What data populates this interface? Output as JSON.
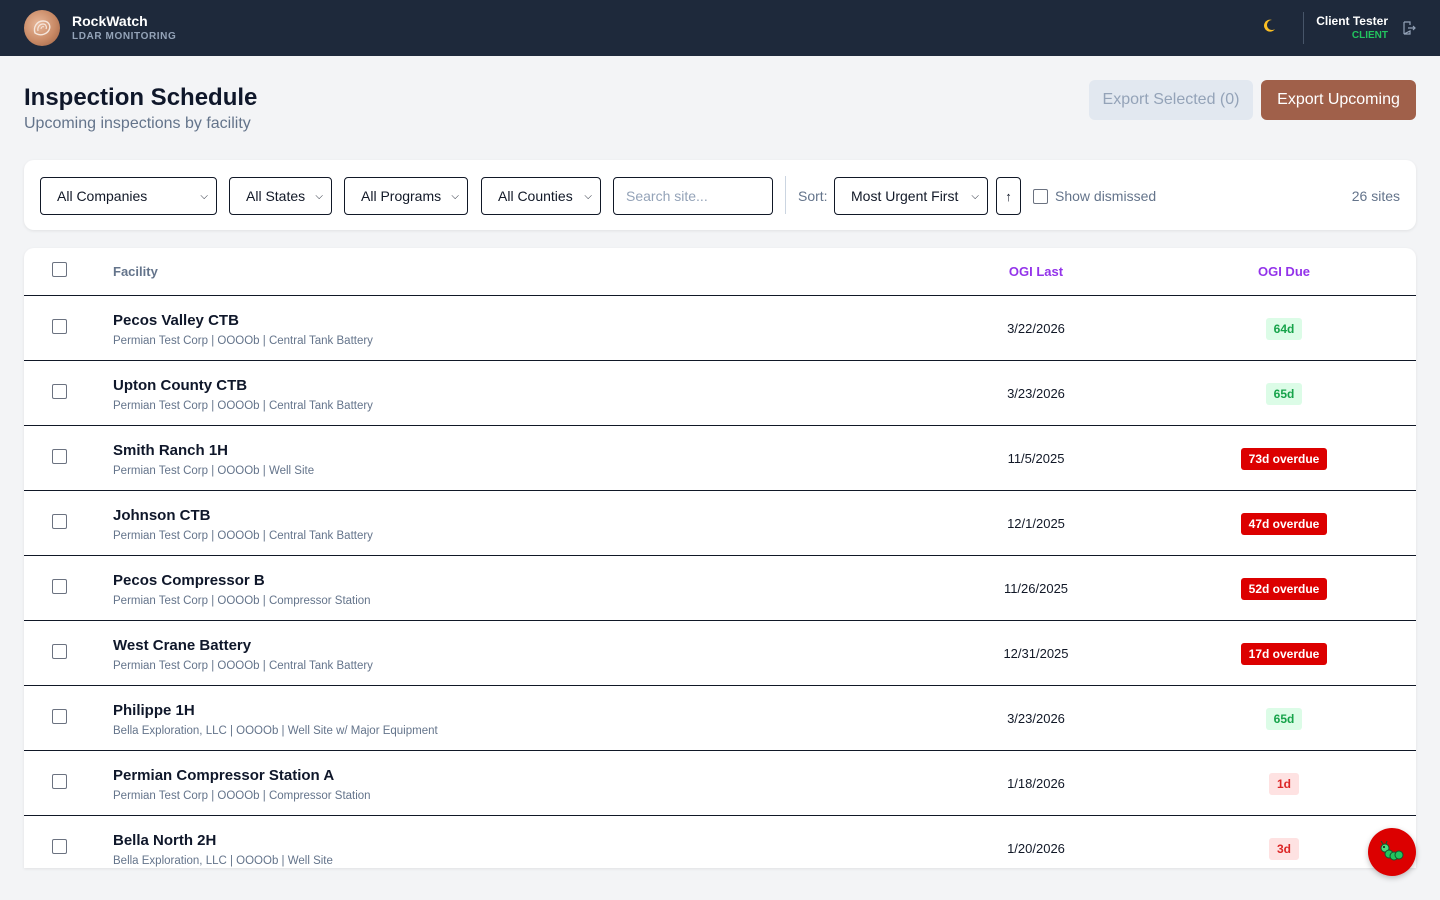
{
  "app": {
    "name": "RockWatch",
    "subtitle": "LDAR MONITORING",
    "logo_icon": "rock-logo-icon"
  },
  "user": {
    "name": "Client Tester",
    "role": "CLIENT",
    "theme_icon": "moon-icon",
    "logout_icon": "logout-icon"
  },
  "header": {
    "title": "Inspection Schedule",
    "subtitle": "Upcoming inspections by facility",
    "export_selected_label": "Export Selected (0)",
    "export_upcoming_label": "Export Upcoming"
  },
  "filters": {
    "company": "All Companies",
    "state": "All States",
    "program": "All Programs",
    "county": "All Counties",
    "search_placeholder": "Search site...",
    "sort_label": "Sort:",
    "sort_value": "Most Urgent First",
    "sort_direction": "↑",
    "show_dismissed_label": "Show dismissed",
    "site_count": "26 sites"
  },
  "table": {
    "columns": {
      "facility": "Facility",
      "ogi_last": "OGI Last",
      "ogi_due": "OGI Due"
    },
    "rows": [
      {
        "name": "Pecos Valley CTB",
        "meta": "Permian Test Corp | OOOOb | Central Tank Battery",
        "ogi_last": "3/22/2026",
        "ogi_due": "64d",
        "status": "ok"
      },
      {
        "name": "Upton County CTB",
        "meta": "Permian Test Corp | OOOOb | Central Tank Battery",
        "ogi_last": "3/23/2026",
        "ogi_due": "65d",
        "status": "ok"
      },
      {
        "name": "Smith Ranch 1H",
        "meta": "Permian Test Corp | OOOOb | Well Site",
        "ogi_last": "11/5/2025",
        "ogi_due": "73d overdue",
        "status": "over"
      },
      {
        "name": "Johnson CTB",
        "meta": "Permian Test Corp | OOOOb | Central Tank Battery",
        "ogi_last": "12/1/2025",
        "ogi_due": "47d overdue",
        "status": "over"
      },
      {
        "name": "Pecos Compressor B",
        "meta": "Permian Test Corp | OOOOb | Compressor Station",
        "ogi_last": "11/26/2025",
        "ogi_due": "52d overdue",
        "status": "over"
      },
      {
        "name": "West Crane Battery",
        "meta": "Permian Test Corp | OOOOb | Central Tank Battery",
        "ogi_last": "12/31/2025",
        "ogi_due": "17d overdue",
        "status": "over"
      },
      {
        "name": "Philippe 1H",
        "meta": "Bella Exploration, LLC | OOOOb | Well Site w/ Major Equipment",
        "ogi_last": "3/23/2026",
        "ogi_due": "65d",
        "status": "ok"
      },
      {
        "name": "Permian Compressor Station A",
        "meta": "Permian Test Corp | OOOOb | Compressor Station",
        "ogi_last": "1/18/2026",
        "ogi_due": "1d",
        "status": "warn"
      },
      {
        "name": "Bella North 2H",
        "meta": "Bella Exploration, LLC | OOOOb | Well Site",
        "ogi_last": "1/20/2026",
        "ogi_due": "3d",
        "status": "warn"
      }
    ]
  },
  "fab": {
    "icon": "caterpillar-bug-icon"
  },
  "colors": {
    "topbar": "#1e293b",
    "accent": "#a0604a",
    "overdue": "#dc0000",
    "ok": "#16a34a",
    "column_header": "#9333ea"
  }
}
